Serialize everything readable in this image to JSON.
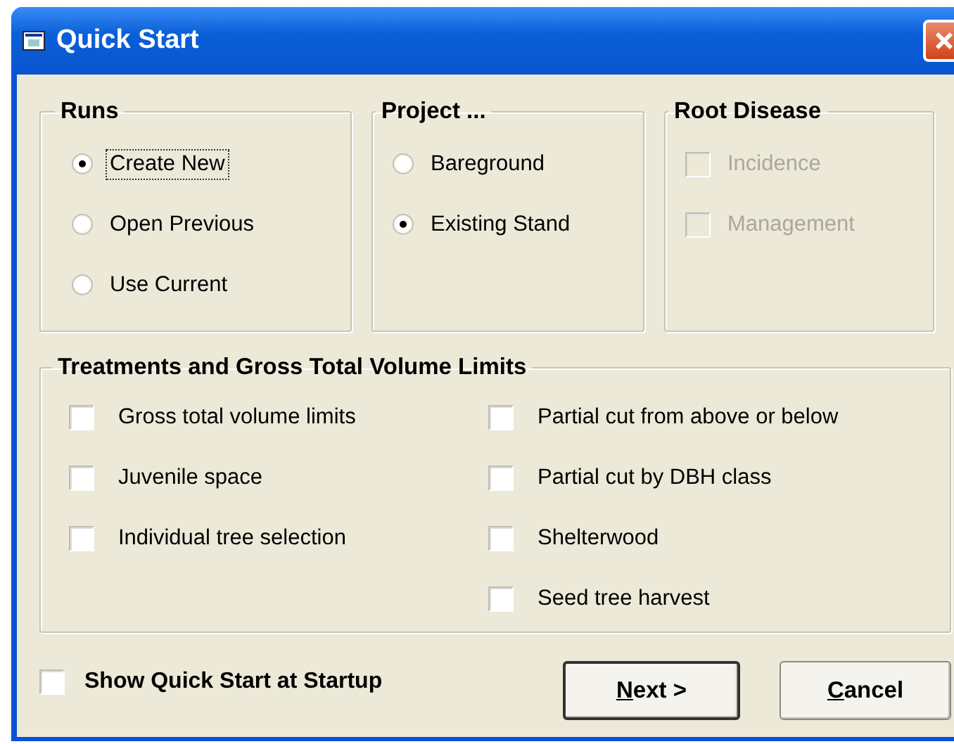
{
  "window": {
    "title": "Quick Start"
  },
  "groups": [
    {
      "title": "Runs",
      "kind": "radio",
      "items": [
        {
          "label": "Create New",
          "selected": true,
          "focused": true
        },
        {
          "label": "Open Previous",
          "selected": false,
          "focused": false
        },
        {
          "label": "Use Current",
          "selected": false,
          "focused": false
        }
      ]
    },
    {
      "title": "Project ...",
      "kind": "radio",
      "items": [
        {
          "label": "Bareground",
          "selected": false,
          "focused": false
        },
        {
          "label": "Existing Stand",
          "selected": true,
          "focused": false
        }
      ]
    },
    {
      "title": "Root Disease",
      "kind": "checkbox",
      "items": [
        {
          "label": "Incidence",
          "checked": false,
          "disabled": true
        },
        {
          "label": "Management",
          "checked": false,
          "disabled": true
        }
      ]
    }
  ],
  "treatments": {
    "title": "Treatments and Gross Total Volume Limits",
    "left": [
      {
        "label": "Gross total volume limits",
        "checked": false
      },
      {
        "label": "Juvenile space",
        "checked": false
      },
      {
        "label": "Individual tree selection",
        "checked": false
      }
    ],
    "right": [
      {
        "label": "Partial cut from above or below",
        "checked": false
      },
      {
        "label": "Partial cut by DBH class",
        "checked": false
      },
      {
        "label": "Shelterwood",
        "checked": false
      },
      {
        "label": "Seed tree harvest",
        "checked": false
      }
    ]
  },
  "show_at_startup": {
    "label": "Show Quick Start at Startup",
    "checked": false
  },
  "buttons": [
    {
      "label": "Next >",
      "first_letter_underlined": true,
      "default": true
    },
    {
      "label": "Cancel",
      "first_letter_underlined": true,
      "default": false
    }
  ]
}
